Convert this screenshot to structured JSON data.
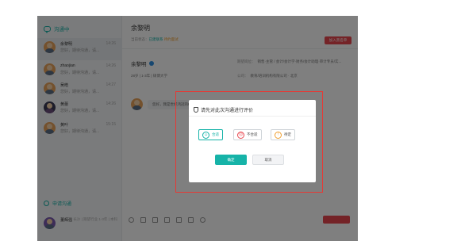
{
  "sidebar": {
    "title": "沟通中",
    "chats": [
      {
        "name": "余黎明",
        "msg": "您好，期待沟通，请...",
        "time": "14:26"
      },
      {
        "name": "zhaojian",
        "msg": "您好，期待沟通，请...",
        "time": "14:26"
      },
      {
        "name": "吴皓",
        "msg": "您好，期待沟通，请...",
        "time": "14:27"
      },
      {
        "name": "黄蕾",
        "msg": "您好，期待沟通，请...",
        "time": "14:26"
      },
      {
        "name": "黄叶",
        "msg": "您好，期待沟通，请...",
        "time": "15:15"
      }
    ],
    "apply_title": "申请沟通",
    "apply_item": {
      "name": "董辉强",
      "sub": "长沙 | 期望行业 1-3年 | 本科"
    }
  },
  "main": {
    "title": "余黎明",
    "status_prefix": "当前状态：",
    "status_green": "已建联系",
    "status_orange": "待约面试",
    "report_label": "加入黑名单",
    "card_name": "余黎明",
    "card_sub": "28岁 | 1-3年 | 硕博大学",
    "card_lines": [
      {
        "k": "期望岗位：",
        "v": "销售·主管 / 会计/会计学·财务/会计助理·审计专员/实..."
      },
      {
        "k": "公司：",
        "v": "教育/培训机构有限公司 · 北京"
      }
    ],
    "message": "您好，我是世纪鸿冠的HR，期待您的回复"
  },
  "dialog": {
    "title": "请先对此次沟通进行评价",
    "options": [
      {
        "label": "合适",
        "icon": "smile-face-icon",
        "glyph": "☺",
        "selected": true
      },
      {
        "label": "不合适",
        "icon": "sad-face-icon",
        "glyph": "☹",
        "selected": false
      },
      {
        "label": "待定",
        "icon": "exclaim-icon",
        "glyph": "!",
        "selected": false
      }
    ],
    "confirm": "确定",
    "cancel": "取消"
  },
  "colors": {
    "accent": "#16b3a8",
    "danger": "#e8474f",
    "warning": "#f0a030",
    "highlight": "#e53935"
  }
}
